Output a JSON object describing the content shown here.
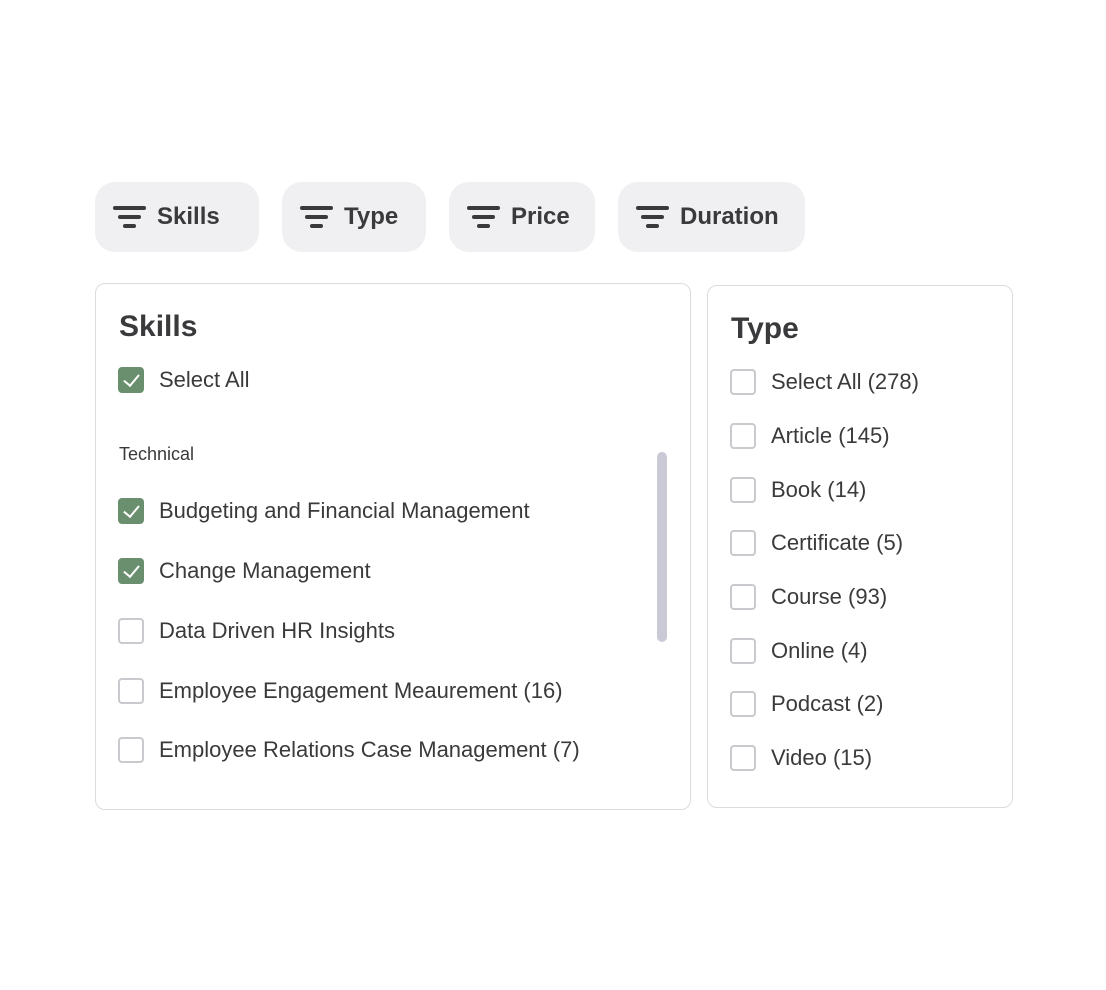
{
  "filters": [
    {
      "label": "Skills",
      "icon": "filter-icon"
    },
    {
      "label": "Type",
      "icon": "filter-icon"
    },
    {
      "label": "Price",
      "icon": "filter-icon"
    },
    {
      "label": "Duration",
      "icon": "filter-icon"
    }
  ],
  "skills_panel": {
    "title": "Skills",
    "select_all": {
      "label": "Select All",
      "checked": true
    },
    "group_label": "Technical",
    "items": [
      {
        "label": "Budgeting and Financial Management",
        "checked": true
      },
      {
        "label": "Change Management",
        "checked": true
      },
      {
        "label": "Data Driven HR Insights",
        "checked": false
      },
      {
        "label": "Employee Engagement Meaurement (16)",
        "checked": false
      },
      {
        "label": "Employee Relations Case Management (7)",
        "checked": false
      }
    ]
  },
  "type_panel": {
    "title": "Type",
    "items": [
      {
        "label": "Select All (278)",
        "checked": false
      },
      {
        "label": "Article (145)",
        "checked": false
      },
      {
        "label": "Book (14)",
        "checked": false
      },
      {
        "label": "Certificate (5)",
        "checked": false
      },
      {
        "label": "Course (93)",
        "checked": false
      },
      {
        "label": "Online (4)",
        "checked": false
      },
      {
        "label": "Podcast (2)",
        "checked": false
      },
      {
        "label": "Video (15)",
        "checked": false
      }
    ]
  },
  "colors": {
    "chip_background": "#f0f0f2",
    "checked": "#6a8f6e",
    "text": "#3a3a3c",
    "scrollbar": "#cacad6"
  }
}
